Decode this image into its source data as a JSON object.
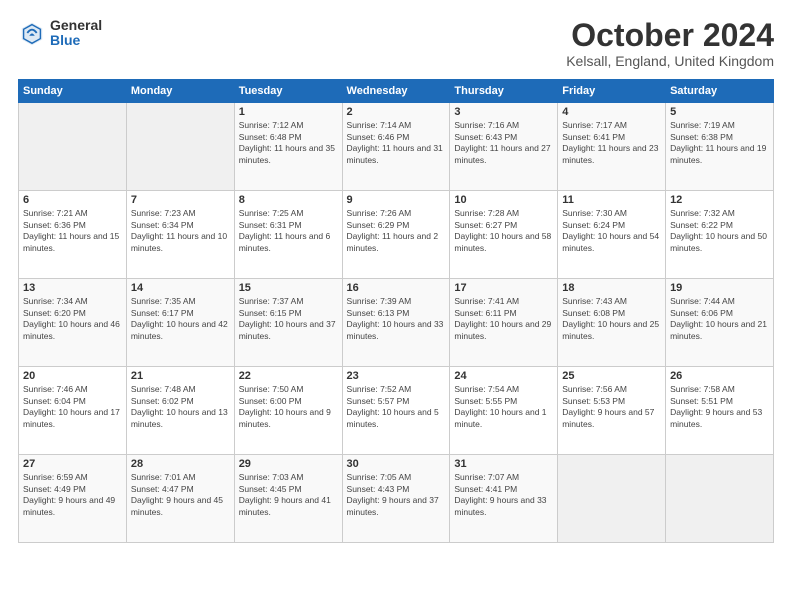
{
  "header": {
    "logo_general": "General",
    "logo_blue": "Blue",
    "title": "October 2024",
    "subtitle": "Kelsall, England, United Kingdom"
  },
  "days_of_week": [
    "Sunday",
    "Monday",
    "Tuesday",
    "Wednesday",
    "Thursday",
    "Friday",
    "Saturday"
  ],
  "weeks": [
    [
      {
        "day": "",
        "info": ""
      },
      {
        "day": "",
        "info": ""
      },
      {
        "day": "1",
        "info": "Sunrise: 7:12 AM\nSunset: 6:48 PM\nDaylight: 11 hours and 35 minutes."
      },
      {
        "day": "2",
        "info": "Sunrise: 7:14 AM\nSunset: 6:46 PM\nDaylight: 11 hours and 31 minutes."
      },
      {
        "day": "3",
        "info": "Sunrise: 7:16 AM\nSunset: 6:43 PM\nDaylight: 11 hours and 27 minutes."
      },
      {
        "day": "4",
        "info": "Sunrise: 7:17 AM\nSunset: 6:41 PM\nDaylight: 11 hours and 23 minutes."
      },
      {
        "day": "5",
        "info": "Sunrise: 7:19 AM\nSunset: 6:38 PM\nDaylight: 11 hours and 19 minutes."
      }
    ],
    [
      {
        "day": "6",
        "info": "Sunrise: 7:21 AM\nSunset: 6:36 PM\nDaylight: 11 hours and 15 minutes."
      },
      {
        "day": "7",
        "info": "Sunrise: 7:23 AM\nSunset: 6:34 PM\nDaylight: 11 hours and 10 minutes."
      },
      {
        "day": "8",
        "info": "Sunrise: 7:25 AM\nSunset: 6:31 PM\nDaylight: 11 hours and 6 minutes."
      },
      {
        "day": "9",
        "info": "Sunrise: 7:26 AM\nSunset: 6:29 PM\nDaylight: 11 hours and 2 minutes."
      },
      {
        "day": "10",
        "info": "Sunrise: 7:28 AM\nSunset: 6:27 PM\nDaylight: 10 hours and 58 minutes."
      },
      {
        "day": "11",
        "info": "Sunrise: 7:30 AM\nSunset: 6:24 PM\nDaylight: 10 hours and 54 minutes."
      },
      {
        "day": "12",
        "info": "Sunrise: 7:32 AM\nSunset: 6:22 PM\nDaylight: 10 hours and 50 minutes."
      }
    ],
    [
      {
        "day": "13",
        "info": "Sunrise: 7:34 AM\nSunset: 6:20 PM\nDaylight: 10 hours and 46 minutes."
      },
      {
        "day": "14",
        "info": "Sunrise: 7:35 AM\nSunset: 6:17 PM\nDaylight: 10 hours and 42 minutes."
      },
      {
        "day": "15",
        "info": "Sunrise: 7:37 AM\nSunset: 6:15 PM\nDaylight: 10 hours and 37 minutes."
      },
      {
        "day": "16",
        "info": "Sunrise: 7:39 AM\nSunset: 6:13 PM\nDaylight: 10 hours and 33 minutes."
      },
      {
        "day": "17",
        "info": "Sunrise: 7:41 AM\nSunset: 6:11 PM\nDaylight: 10 hours and 29 minutes."
      },
      {
        "day": "18",
        "info": "Sunrise: 7:43 AM\nSunset: 6:08 PM\nDaylight: 10 hours and 25 minutes."
      },
      {
        "day": "19",
        "info": "Sunrise: 7:44 AM\nSunset: 6:06 PM\nDaylight: 10 hours and 21 minutes."
      }
    ],
    [
      {
        "day": "20",
        "info": "Sunrise: 7:46 AM\nSunset: 6:04 PM\nDaylight: 10 hours and 17 minutes."
      },
      {
        "day": "21",
        "info": "Sunrise: 7:48 AM\nSunset: 6:02 PM\nDaylight: 10 hours and 13 minutes."
      },
      {
        "day": "22",
        "info": "Sunrise: 7:50 AM\nSunset: 6:00 PM\nDaylight: 10 hours and 9 minutes."
      },
      {
        "day": "23",
        "info": "Sunrise: 7:52 AM\nSunset: 5:57 PM\nDaylight: 10 hours and 5 minutes."
      },
      {
        "day": "24",
        "info": "Sunrise: 7:54 AM\nSunset: 5:55 PM\nDaylight: 10 hours and 1 minute."
      },
      {
        "day": "25",
        "info": "Sunrise: 7:56 AM\nSunset: 5:53 PM\nDaylight: 9 hours and 57 minutes."
      },
      {
        "day": "26",
        "info": "Sunrise: 7:58 AM\nSunset: 5:51 PM\nDaylight: 9 hours and 53 minutes."
      }
    ],
    [
      {
        "day": "27",
        "info": "Sunrise: 6:59 AM\nSunset: 4:49 PM\nDaylight: 9 hours and 49 minutes."
      },
      {
        "day": "28",
        "info": "Sunrise: 7:01 AM\nSunset: 4:47 PM\nDaylight: 9 hours and 45 minutes."
      },
      {
        "day": "29",
        "info": "Sunrise: 7:03 AM\nSunset: 4:45 PM\nDaylight: 9 hours and 41 minutes."
      },
      {
        "day": "30",
        "info": "Sunrise: 7:05 AM\nSunset: 4:43 PM\nDaylight: 9 hours and 37 minutes."
      },
      {
        "day": "31",
        "info": "Sunrise: 7:07 AM\nSunset: 4:41 PM\nDaylight: 9 hours and 33 minutes."
      },
      {
        "day": "",
        "info": ""
      },
      {
        "day": "",
        "info": ""
      }
    ]
  ]
}
